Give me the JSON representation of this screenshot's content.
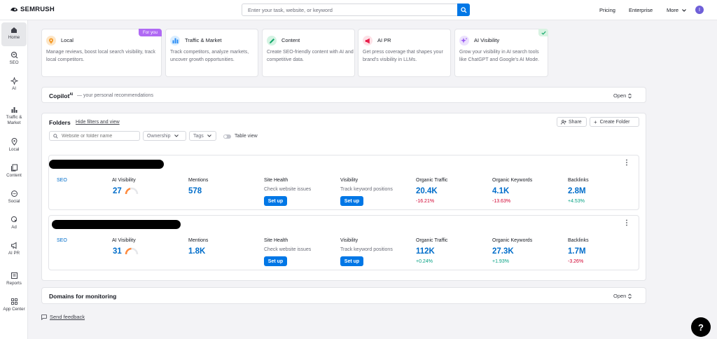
{
  "brand": "SEMRUSH",
  "search": {
    "placeholder": "Enter your task, website, or keyword"
  },
  "topnav": {
    "pricing": "Pricing",
    "enterprise": "Enterprise",
    "more": "More",
    "avatar_initial": "I"
  },
  "sidebar": [
    {
      "label": "Home",
      "icon": "home-icon"
    },
    {
      "label": "SEO",
      "icon": "seo-icon"
    },
    {
      "label": "AI",
      "icon": "ai-icon"
    },
    {
      "label": "Traffic & Market",
      "icon": "traffic-icon"
    },
    {
      "label": "Local",
      "icon": "location-pin-icon"
    },
    {
      "label": "Content",
      "icon": "content-icon"
    },
    {
      "label": "Social",
      "icon": "social-icon"
    },
    {
      "label": "Ad",
      "icon": "ad-icon"
    },
    {
      "label": "AI PR",
      "icon": "megaphone-icon"
    },
    {
      "label": "Reports",
      "icon": "reports-icon"
    },
    {
      "label": "App Center",
      "icon": "app-center-icon"
    }
  ],
  "features": [
    {
      "title": "Local",
      "desc": "Manage reviews, boost local search visibility, track local competitors.",
      "badge": "For you"
    },
    {
      "title": "Traffic & Market",
      "desc": "Track competitors, analyze markets, uncover growth opportunities."
    },
    {
      "title": "Content",
      "desc": "Create SEO-friendly content with AI and competitive data."
    },
    {
      "title": "AI PR",
      "desc": "Get press coverage that shapes your brand's visibility in LLMs."
    },
    {
      "title": "AI Visibility",
      "desc": "Grow your visibility in AI search tools like ChatGPT and Google's AI Mode."
    }
  ],
  "copilot": {
    "title": "Copilot",
    "sup": "AI",
    "subtitle": "— your personal recommendations",
    "open": "Open"
  },
  "folders": {
    "title": "Folders",
    "hide_link": "Hide filters and view",
    "share": "Share",
    "create": "Create Folder",
    "search_placeholder": "Website or folder name",
    "ownership": "Ownership",
    "tags": "Tags",
    "table_view": "Table view"
  },
  "projects": [
    {
      "seo": "SEO",
      "ai_visibility_label": "AI Visibility",
      "ai_visibility": "27",
      "mentions_label": "Mentions",
      "mentions": "578",
      "site_health_label": "Site Health",
      "site_health_sub": "Check website issues",
      "site_health_btn": "Set up",
      "visibility_label": "Visibility",
      "visibility_sub": "Track keyword positions",
      "visibility_btn": "Set up",
      "organic_traffic_label": "Organic Traffic",
      "organic_traffic": "20.4K",
      "organic_traffic_delta": "-16.21%",
      "organic_keywords_label": "Organic Keywords",
      "organic_keywords": "4.1K",
      "organic_keywords_delta": "-13.63%",
      "backlinks_label": "Backlinks",
      "backlinks": "2.8M",
      "backlinks_delta": "+4.53%"
    },
    {
      "seo": "SEO",
      "ai_visibility_label": "AI Visibility",
      "ai_visibility": "31",
      "mentions_label": "Mentions",
      "mentions": "1.8K",
      "site_health_label": "Site Health",
      "site_health_sub": "Check website issues",
      "site_health_btn": "Set up",
      "visibility_label": "Visibility",
      "visibility_sub": "Track keyword positions",
      "visibility_btn": "Set up",
      "organic_traffic_label": "Organic Traffic",
      "organic_traffic": "112K",
      "organic_traffic_delta": "+0.24%",
      "organic_keywords_label": "Organic Keywords",
      "organic_keywords": "27.3K",
      "organic_keywords_delta": "+1.93%",
      "backlinks_label": "Backlinks",
      "backlinks": "1.7M",
      "backlinks_delta": "-3.26%"
    }
  ],
  "domains": {
    "title": "Domains for monitoring",
    "open": "Open"
  },
  "feedback": "Send feedback",
  "help": "?",
  "colors": {
    "accent": "#0077e6",
    "link": "#006dca",
    "negative": "#d1002f",
    "positive": "#009f81",
    "badge": "#b06af4"
  }
}
